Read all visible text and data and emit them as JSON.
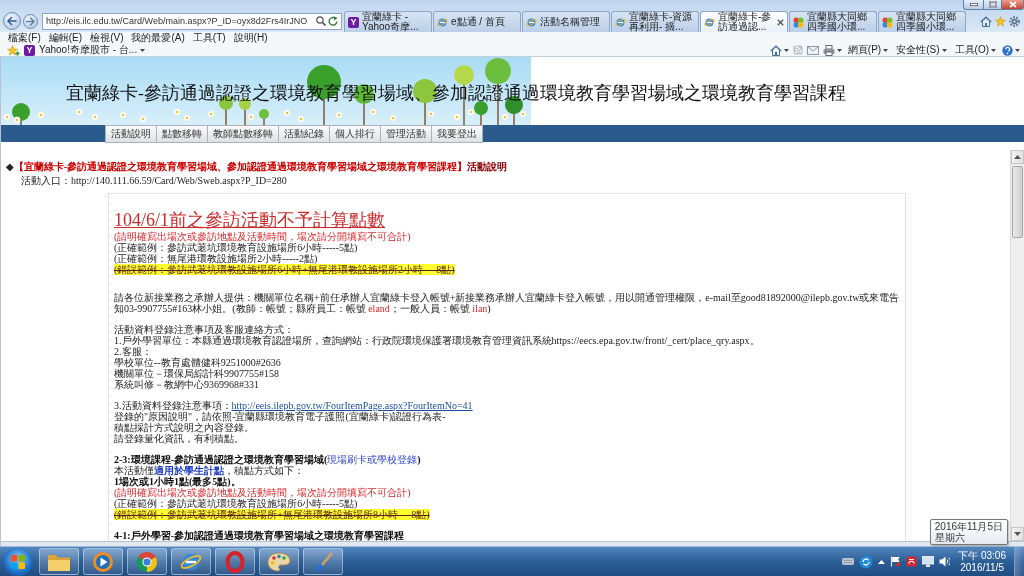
{
  "browser": {
    "address": {
      "value": "http://eis.ilc.edu.tw/Card/Web/main.aspx?P_ID=oyx8d2Frs4IrJNO"
    },
    "tabs": [
      {
        "label": "宜蘭綠卡 - Yahoo奇摩...",
        "kind": "letter-tile",
        "icon_letter": "Y",
        "selected": false
      },
      {
        "label": "e點通 / 首頁",
        "kind": "page",
        "selected": false
      },
      {
        "label": "活動名稱管理",
        "kind": "page",
        "selected": false
      },
      {
        "label": "宜蘭綠卡-資源再利用- 摘...",
        "kind": "page",
        "selected": false
      },
      {
        "label": "宜蘭綠卡-參訪通過認...",
        "kind": "page",
        "selected": true
      },
      {
        "label": "宜蘭縣大同鄉四季國小環...",
        "kind": "pinwheel",
        "selected": false
      },
      {
        "label": "宜蘭縣大同鄉四季國小環...",
        "kind": "pinwheel",
        "selected": false
      }
    ],
    "menu": [
      "檔案(F)",
      "編輯(E)",
      "檢視(V)",
      "我的最愛(A)",
      "工具(T)",
      "說明(H)"
    ],
    "favorites": [
      {
        "label": "Yahoo!奇摩股市 - 台...",
        "icon_letter": "Y"
      }
    ],
    "command_bar": [
      "網頁(P)",
      "安全性(S)",
      "工具(O)"
    ]
  },
  "site": {
    "title": "宜蘭綠卡-參訪通過認證之環境教育學習場域、參加認證通過環境教育學習場域之環境教育學習課程",
    "nav": [
      "活動說明",
      "點數移轉",
      "教師點數移轉",
      "活動紀錄",
      "個人排行",
      "管理活動",
      "我要登出"
    ]
  },
  "content": {
    "heading": [
      {
        "text": "◆",
        "kind": "plain"
      },
      {
        "text": "【宜蘭綠卡-參訪通過認證之環境教育學習場域、參加認證通過環境教育學習場域之環境教育學習課程】",
        "kind": "red"
      },
      {
        "text": "活動說明",
        "kind": "dark-red"
      }
    ],
    "entrance": "活動入口：http://140.111.66.59/Card/Web/Sweb.aspx?P_ID=280",
    "blocks": [
      [
        {
          "kind": "title",
          "text": "104/6/1前之參訪活動不予計算點數"
        },
        {
          "kind": "warning",
          "text": "(請明確寫出場次或參訪地點及活動時間，場次請分開填寫不可合計)"
        },
        {
          "kind": "plain",
          "text": "(正確範例：參訪武荖坑環境教育設施場所6小時-----5點)"
        },
        {
          "kind": "plain",
          "text": "(正確範例：無尾港環教設施場所2小時-----2點)"
        },
        {
          "kind": "struck",
          "text": "(錯誤範例：參訪武荖坑環教設施場所6小時+無尾港環教設施場所2小時----8點)"
        }
      ],
      [
        {
          "kind": "paragraph",
          "parts": [
            {
              "text": "請各位新接業務之承辦人提供：機關單位名稱+前任承辦人宜蘭綠卡登入帳號+新接業務承辦人宜蘭綠卡登入帳號，用以開通管理權限，e-mail至good81892000@ilepb.gov.tw或來電告知03-9907755#163林小姐。(教師：帳號；縣府員工：帳號 ",
              "kind": "plain"
            },
            {
              "text": "eland",
              "kind": "red"
            },
            {
              "text": "；一般人員：帳號 ",
              "kind": "plain"
            },
            {
              "text": "ilan",
              "kind": "red"
            },
            {
              "text": ")",
              "kind": "plain"
            }
          ]
        }
      ],
      [
        {
          "kind": "plain",
          "text": "活動資料登錄注意事項及客服連絡方式："
        },
        {
          "kind": "plain",
          "text": "1.戶外學習單位：本縣通過環境教育認證場所，查詢網站：行政院環境保護署環境教育管理資訊系統https://eecs.epa.gov.tw/front/_cert/place_qry.aspx。"
        },
        {
          "kind": "plain",
          "text": "2.客服："
        },
        {
          "kind": "plain",
          "text": "學校單位--教育處體健科9251000#2636"
        },
        {
          "kind": "plain",
          "text": "機關單位－環保局綜計科9907755#158"
        },
        {
          "kind": "plain",
          "text": "系統叫修－教網中心9369968#331"
        }
      ],
      [
        {
          "kind": "plain",
          "parts": [
            {
              "text": "3.活動資料登錄注意事項：",
              "kind": "plain"
            },
            {
              "text": "http://eeis.ilepb.gov.tw/FourItemPage.aspx?FourItemNo=41",
              "kind": "link"
            }
          ]
        },
        {
          "kind": "plain",
          "text": "登錄的\"原因說明\"，請依照-宜蘭縣環境教育電子護照(宜蘭綠卡)認證行為表-"
        },
        {
          "kind": "plain",
          "text": "積點採計方式說明之內容登錄。"
        },
        {
          "kind": "plain",
          "text": "請登錄量化資訊，有利積點。"
        }
      ],
      [
        {
          "kind": "bold",
          "parts": [
            {
              "text": "2-3:環境課程-參訪通過認證之環境教育學習場域(",
              "kind": "plain"
            },
            {
              "text": "現場刷卡或學校登錄",
              "kind": "blue"
            },
            {
              "text": ")",
              "kind": "plain"
            }
          ]
        },
        {
          "kind": "plain",
          "parts": [
            {
              "text": "本活動僅",
              "kind": "plain"
            },
            {
              "text": "適用於學生計點",
              "kind": "strong-blue"
            },
            {
              "text": "，積點方式如下：",
              "kind": "plain"
            }
          ]
        },
        {
          "kind": "bold",
          "text": "1場次或1小時1點(最多5點)。"
        },
        {
          "kind": "warning",
          "text": "(請明確寫出場次或參訪地點及活動時間，場次請分開填寫不可合計)"
        },
        {
          "kind": "plain",
          "text": "(正確範例：參訪武荖坑環境教育設施場所6小時-----5點)"
        },
        {
          "kind": "struck",
          "text": "(錯誤範例：參訪武荖坑環教設施場所+無尾港環教設施場所8小時----8點)"
        }
      ],
      [
        {
          "kind": "bold",
          "text": "4-1:戶外學習-參加認證通過環境教育學習場域之環境教育學習課程"
        }
      ]
    ]
  },
  "taskbar": {
    "clock": {
      "time": "下午 03:06",
      "date": "2016/11/5"
    },
    "tooltip": [
      "2016年11月5日",
      "星期六"
    ]
  }
}
